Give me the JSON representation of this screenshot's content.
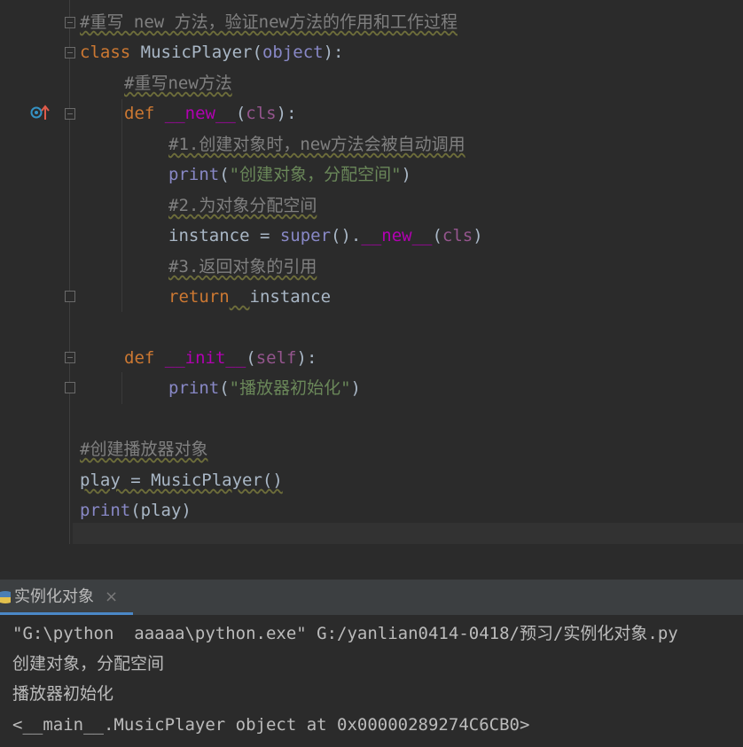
{
  "editor": {
    "lines": [
      {
        "id": "l1",
        "tokens": [
          {
            "t": "#重写 new 方法，验证new方法的作用和工作过程",
            "c": "cm"
          }
        ]
      },
      {
        "id": "l2",
        "tokens": [
          {
            "t": "class ",
            "c": "kw"
          },
          {
            "t": "MusicPlayer",
            "c": "cls"
          },
          {
            "t": "(",
            "c": "plain"
          },
          {
            "t": "object",
            "c": "builtin"
          },
          {
            "t": "):",
            "c": "plain"
          }
        ]
      },
      {
        "id": "l3",
        "tokens": [
          {
            "t": "#重写new方法",
            "c": "cm"
          }
        ]
      },
      {
        "id": "l4",
        "tokens": [
          {
            "t": "def ",
            "c": "kw"
          },
          {
            "t": "__new__",
            "c": "magic"
          },
          {
            "t": "(",
            "c": "plain"
          },
          {
            "t": "cls",
            "c": "self"
          },
          {
            "t": "):",
            "c": "plain"
          }
        ]
      },
      {
        "id": "l5",
        "tokens": [
          {
            "t": "#1.创建对象时，new方法会被自动调用",
            "c": "cm"
          }
        ]
      },
      {
        "id": "l6",
        "tokens": [
          {
            "t": "print",
            "c": "builtin"
          },
          {
            "t": "(",
            "c": "plain"
          },
          {
            "t": "\"创建对象，分配空间\"",
            "c": "str"
          },
          {
            "t": ")",
            "c": "plain"
          }
        ]
      },
      {
        "id": "l7",
        "tokens": [
          {
            "t": "#2.为对象分配空间",
            "c": "cm"
          }
        ]
      },
      {
        "id": "l8",
        "tokens": [
          {
            "t": "instance = ",
            "c": "plain"
          },
          {
            "t": "super",
            "c": "builtin"
          },
          {
            "t": "().",
            "c": "plain"
          },
          {
            "t": "__new__",
            "c": "magic"
          },
          {
            "t": "(",
            "c": "plain"
          },
          {
            "t": "cls",
            "c": "self"
          },
          {
            "t": ")",
            "c": "plain"
          }
        ]
      },
      {
        "id": "l9",
        "tokens": [
          {
            "t": "#3.返回对象的引用",
            "c": "cm"
          }
        ]
      },
      {
        "id": "l10",
        "tokens": [
          {
            "t": "return",
            "c": "kw"
          },
          {
            "t": "  ",
            "c": "warn"
          },
          {
            "t": "instance",
            "c": "plain"
          }
        ]
      },
      {
        "id": "l11",
        "tokens": [
          {
            "t": "def ",
            "c": "kw"
          },
          {
            "t": "__init__",
            "c": "magic"
          },
          {
            "t": "(",
            "c": "plain"
          },
          {
            "t": "self",
            "c": "self"
          },
          {
            "t": "):",
            "c": "plain"
          }
        ]
      },
      {
        "id": "l12",
        "tokens": [
          {
            "t": "print",
            "c": "builtin"
          },
          {
            "t": "(",
            "c": "plain"
          },
          {
            "t": "\"播放器初始化\"",
            "c": "str"
          },
          {
            "t": ")",
            "c": "plain"
          }
        ]
      },
      {
        "id": "l13",
        "tokens": [
          {
            "t": "#创建播放器对象",
            "c": "cm"
          }
        ]
      },
      {
        "id": "l14",
        "tokens": [
          {
            "t": "play = MusicPlayer()",
            "c": "warn"
          }
        ]
      },
      {
        "id": "l15",
        "tokens": [
          {
            "t": "print",
            "c": "builtin"
          },
          {
            "t": "(play)",
            "c": "plain"
          }
        ]
      }
    ]
  },
  "run_panel": {
    "tab_label": "实例化对象",
    "close_glyph": "×",
    "output": [
      "\"G:\\python  aaaaa\\python.exe\" G:/yanlian0414-0418/预习/实例化对象.py",
      "创建对象，分配空间",
      "播放器初始化",
      "<__main__.MusicPlayer object at 0x00000289274C6CB0>"
    ]
  },
  "icons": {
    "override": "override-up-arrow-icon",
    "python": "python-file-icon"
  },
  "colors": {
    "background": "#2b2b2b",
    "keyword": "#cc7832",
    "string": "#6a8759",
    "comment": "#808080",
    "magic_method": "#b200b2",
    "self_param": "#94558d",
    "builtin": "#8888c6",
    "tab_underline": "#4a88c7"
  }
}
